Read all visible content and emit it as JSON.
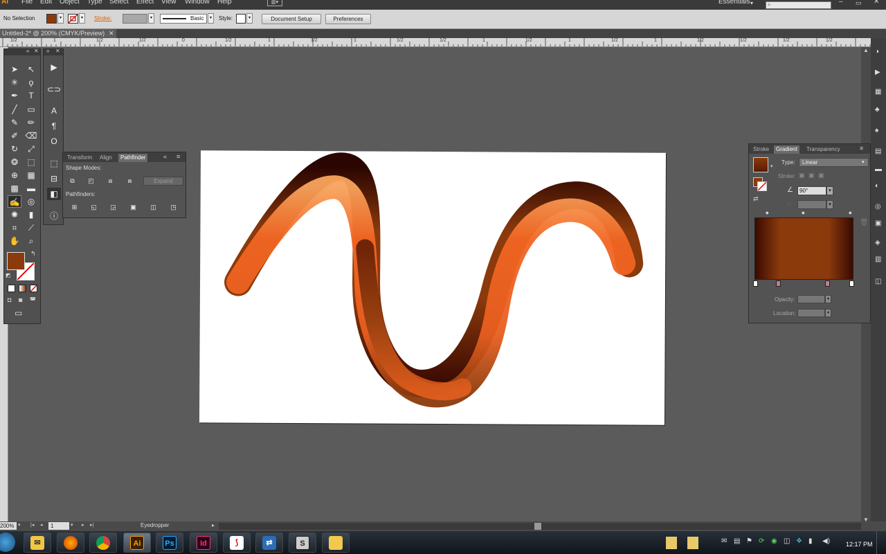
{
  "menu": {
    "logo": "Ai",
    "items": [
      "File",
      "Edit",
      "Object",
      "Type",
      "Select",
      "Effect",
      "View",
      "Window",
      "Help"
    ],
    "workspace": "Essentials",
    "search_placeholder": ""
  },
  "control_bar": {
    "selection": "No Selection",
    "stroke_label": "Stroke:",
    "brush": "Basic",
    "style_label": "Style:",
    "document_setup": "Document Setup",
    "preferences": "Preferences",
    "fill_color": "#8b3a0c"
  },
  "document": {
    "tab": "Untitled-2* @ 200% (CMYK/Preview)"
  },
  "ruler": {
    "labels": [
      "1/2",
      "1",
      "1/2",
      "1/2",
      "0",
      "1/2",
      "1",
      "1/2",
      "1",
      "1/2",
      "1/2",
      "1",
      "1/2",
      "1",
      "1/2",
      "1",
      "1/2",
      "1/2",
      "1/2",
      "1/2"
    ]
  },
  "pathfinder": {
    "tabs": [
      "Transform",
      "Align",
      "Pathfinder"
    ],
    "shape_modes": "Shape Modes:",
    "expand": "Expand",
    "pathfinders": "Pathfinders:"
  },
  "gradient": {
    "tabs": [
      "Stroke",
      "Gradient",
      "Transparency"
    ],
    "type_label": "Type:",
    "type_value": "Linear",
    "stroke_label": "Stroke:",
    "angle": "90°",
    "opacity_label": "Opacity:",
    "location_label": "Location:",
    "colors": {
      "dark": "#3a0a02",
      "mid": "#8b3a0c",
      "light": "#c8581a"
    }
  },
  "status": {
    "zoom": "200%",
    "page": "1",
    "tool": "Eyedropper"
  },
  "taskbar": {
    "apps": [
      "Ai",
      "Ps",
      "Id",
      "S"
    ],
    "time": "12:17 PM"
  },
  "colors": {
    "accent_orange": "#f26522",
    "brown": "#8b3a0c",
    "dark_brown": "#3a0a02"
  }
}
